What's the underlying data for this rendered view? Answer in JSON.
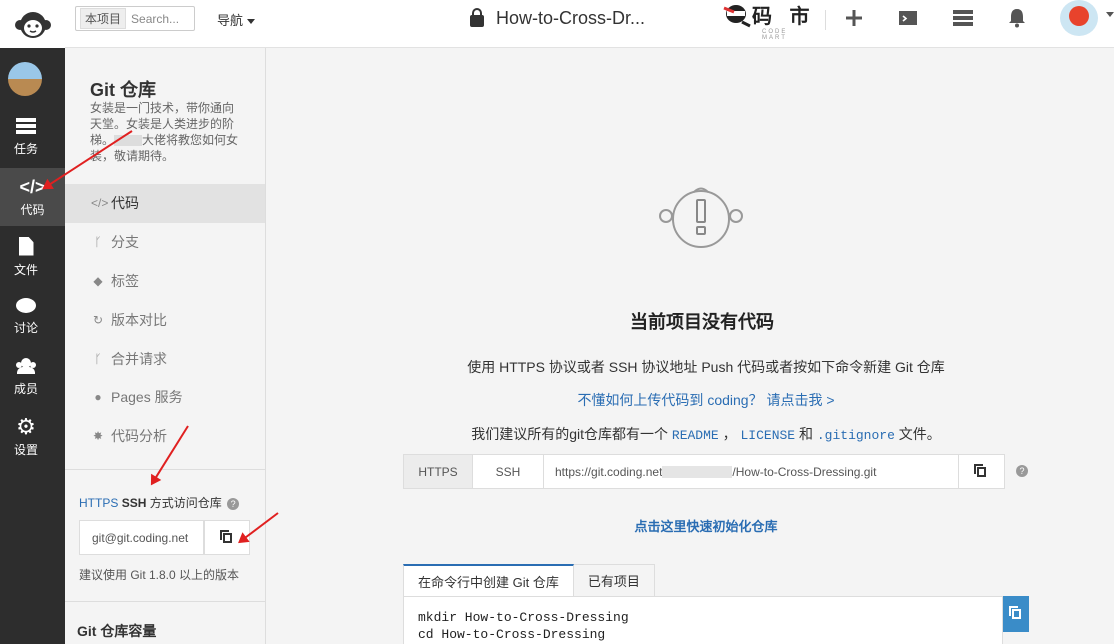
{
  "topbar": {
    "search_scope": "本项目",
    "search_placeholder": "Search...",
    "nav_label": "导航",
    "project_title": "How-to-Cross-Dr...",
    "brand_text": "码 市",
    "brand_sub": "CODE MART"
  },
  "leftbar": {
    "items": [
      {
        "label": "任务",
        "icon": "tasks-icon"
      },
      {
        "label": "代码",
        "icon": "code-icon"
      },
      {
        "label": "文件",
        "icon": "file-icon"
      },
      {
        "label": "讨论",
        "icon": "chat-icon"
      },
      {
        "label": "成员",
        "icon": "members-icon"
      },
      {
        "label": "设置",
        "icon": "settings-icon"
      }
    ],
    "active": "代码"
  },
  "sidebar": {
    "title": "Git 仓库",
    "desc_part1": "女装是一门技术，带你通向天堂。女装是人类进步的阶梯。",
    "desc_part2": "大佬将教您如何女装，敬请期待。",
    "menu": [
      {
        "label": "代码",
        "icon": "</>"
      },
      {
        "label": "分支",
        "icon": "ᚴ"
      },
      {
        "label": "标签",
        "icon": "◆"
      },
      {
        "label": "版本对比",
        "icon": "↻"
      },
      {
        "label": "合并请求",
        "icon": "ᚴ"
      },
      {
        "label": "Pages 服务",
        "icon": "●"
      },
      {
        "label": "代码分析",
        "icon": "✸"
      }
    ],
    "proto_https": "HTTPS",
    "proto_ssh": "SSH",
    "proto_text": "方式访问仓库",
    "ssh_url": "git@git.coding.net",
    "git_note": "建议使用 Git 1.8.0 以上的版本",
    "capacity_title": "Git 仓库容量"
  },
  "main": {
    "empty_title": "当前项目没有代码",
    "line1": "使用 HTTPS 协议或者 SSH 协议地址 Push 代码或者按如下命令新建 Git 仓库",
    "line2": "不懂如何上传代码到 coding？ 请点击我 >",
    "line3_prefix": "我们建议所有的git仓库都有一个",
    "readme": "README",
    "comma": "，",
    "license": "LICENSE",
    "and": "和",
    "gitignore": ".gitignore",
    "line3_suffix": "文件。",
    "tab_https": "HTTPS",
    "tab_ssh": "SSH",
    "url_prefix": "https://git.coding.net",
    "url_suffix": "/How-to-Cross-Dressing.git",
    "init_link": "点击这里快速初始化仓库",
    "cmd_tab1": "在命令行中创建 Git 仓库",
    "cmd_tab2": "已有项目",
    "cmd_line1": "mkdir How-to-Cross-Dressing",
    "cmd_line2": "cd How-to-Cross-Dressing"
  },
  "colors": {
    "accent": "#2a6db3",
    "sidebar_dark": "#2d2d2d",
    "annotation_red": "#e02020"
  }
}
